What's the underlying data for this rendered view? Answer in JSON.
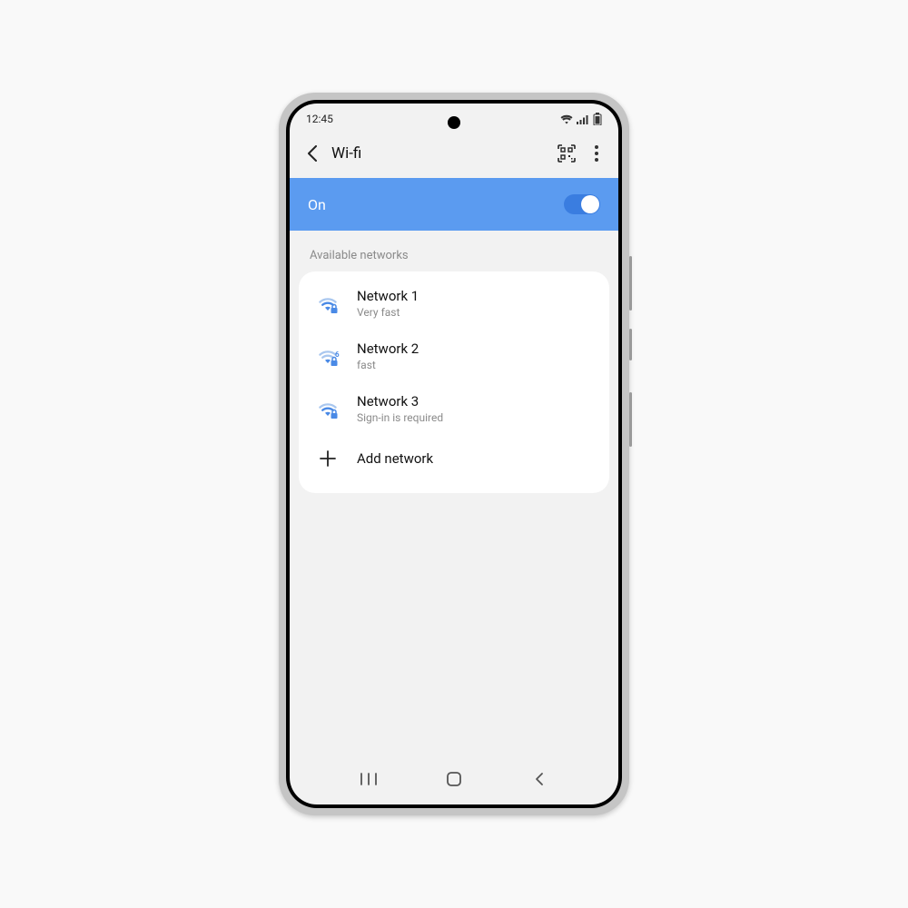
{
  "status": {
    "time": "12:45"
  },
  "header": {
    "title": "Wi-fi",
    "back_icon": "chevron-left",
    "qr_icon": "qr-scan",
    "more_icon": "more-vertical"
  },
  "toggle": {
    "label": "On",
    "state": true
  },
  "section_label": "Available networks",
  "networks": [
    {
      "name": "Network 1",
      "status": "Very fast",
      "badge": ""
    },
    {
      "name": "Network 2",
      "status": "fast",
      "badge": "6"
    },
    {
      "name": "Network 3",
      "status": "Sign-in is required",
      "badge": ""
    }
  ],
  "add_network_label": "Add network",
  "nav": {
    "recents": "recents",
    "home": "home",
    "back": "back"
  },
  "colors": {
    "accent": "#5b9bf0",
    "wifi_icon": "#4a8ae6"
  }
}
